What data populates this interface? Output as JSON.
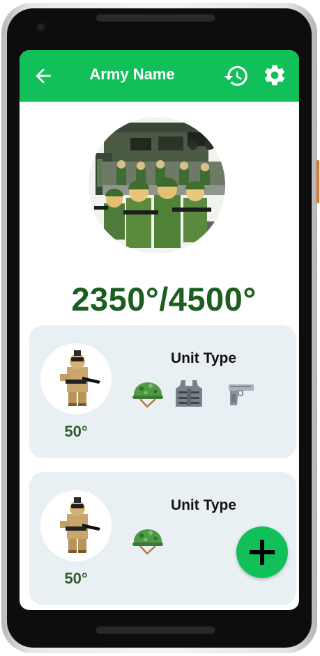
{
  "app_bar": {
    "title": "Army Name",
    "icons": {
      "back": "arrow-left-icon",
      "history": "history-icon",
      "settings": "gear-icon"
    }
  },
  "army": {
    "image": "army-photo",
    "points": "2350°/4500°"
  },
  "units": [
    {
      "type_label": "Unit Type",
      "cost": "50°",
      "equipment": [
        "helmet-icon",
        "vest-icon",
        "pistol-icon"
      ]
    },
    {
      "type_label": "Unit Type",
      "cost": "50°",
      "equipment": [
        "helmet-icon"
      ]
    }
  ],
  "fab": {
    "icon": "plus-icon"
  },
  "colors": {
    "primary": "#12c05a",
    "points_text": "#1b5e20",
    "card_bg": "#e9f0f4"
  }
}
